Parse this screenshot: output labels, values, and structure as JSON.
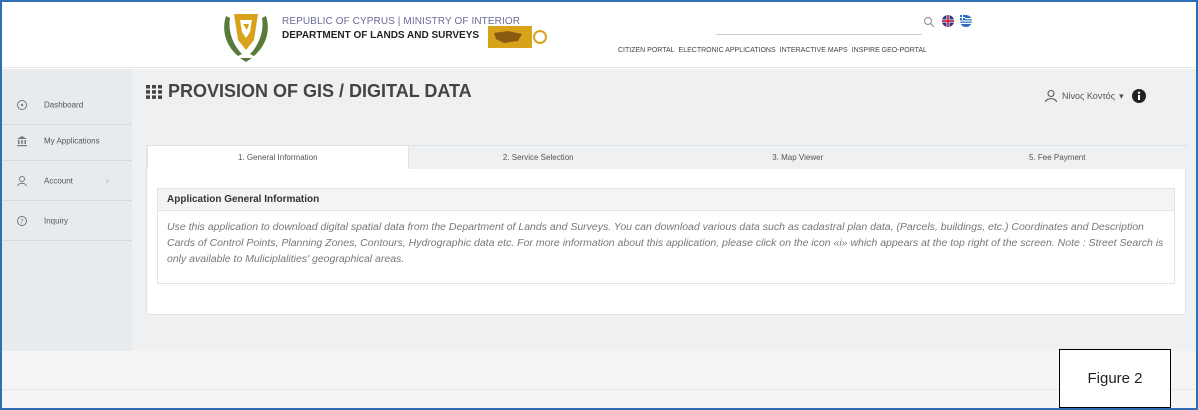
{
  "header": {
    "ministry": "REPUBLIC OF CYPRUS | MINISTRY OF INTERIOR",
    "department": "DEPARTMENT OF LANDS AND SURVEYS",
    "nav": [
      "CITIZEN PORTAL",
      "ELECTRONIC APPLICATIONS",
      "INTERACTIVE MAPS",
      "INSPIRE GEO-PORTAL"
    ]
  },
  "sidebar": {
    "items": [
      {
        "label": "Dashboard",
        "icon": "dashboard-icon"
      },
      {
        "label": "My Applications",
        "icon": "bank-icon"
      },
      {
        "label": "Account",
        "icon": "user-icon",
        "chevron": "›"
      },
      {
        "label": "Inquiry",
        "icon": "question-icon"
      }
    ]
  },
  "main": {
    "title": "PROVISION OF GIS / DIGITAL DATA",
    "user": "Νίνος Κοντός",
    "user_caret": "▾",
    "tabs": [
      "1. General Information",
      "2. Service Selection",
      "3. Map Viewer",
      "5. Fee Payment"
    ],
    "info_card": {
      "heading": "Application General Information",
      "body": "Use this application to download digital spatial data from the Department of Lands and Surveys. You can download various data such as cadastral plan data, (Parcels, buildings, etc.) Coordinates and Description Cards of Control Points, Planning Zones, Contours, Hydrographic data etc. For more information about this application, please click on the icon «i» which appears at the top right of the screen. Note : Street Search is only available to Muliciplalities' geographical areas."
    }
  },
  "figure_label": "Figure 2",
  "colors": {
    "frame": "#2e6fb5",
    "sidebar_bg": "#e8ebee",
    "main_bg": "#eef0f2",
    "logo_gold": "#d9a21b",
    "logo_green": "#5a7a3a"
  }
}
